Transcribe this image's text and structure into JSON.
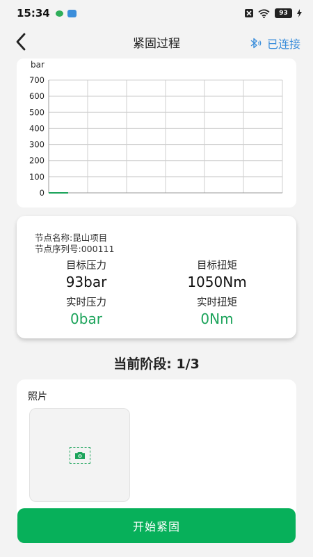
{
  "status_bar": {
    "time": "15:34",
    "battery": "93"
  },
  "header": {
    "title": "紧固过程",
    "connection_status": "已连接"
  },
  "colors": {
    "accent_green": "#07b05a",
    "link_blue": "#3b8edb",
    "value_green": "#1ba35a"
  },
  "chart_data": {
    "type": "line",
    "ylabel": "bar",
    "ylim": [
      0,
      700
    ],
    "yticks": [
      "0",
      "100",
      "200",
      "300",
      "400",
      "500",
      "600",
      "700"
    ],
    "grid": true,
    "x": [
      0,
      1
    ],
    "values": [
      0,
      0
    ],
    "xlim": [
      0,
      12
    ]
  },
  "info": {
    "node_name": "节点名称:昆山项目",
    "node_serial": "节点序列号:000111",
    "target_pressure_label": "目标压力",
    "target_pressure_value": "93bar",
    "target_torque_label": "目标扭矩",
    "target_torque_value": "1050Nm",
    "realtime_pressure_label": "实时压力",
    "realtime_pressure_value": "0bar",
    "realtime_torque_label": "实时扭矩",
    "realtime_torque_value": "0Nm"
  },
  "stage": {
    "text": "当前阶段: 1/3"
  },
  "photo": {
    "label": "照片"
  },
  "actions": {
    "start_label": "开始紧固"
  }
}
